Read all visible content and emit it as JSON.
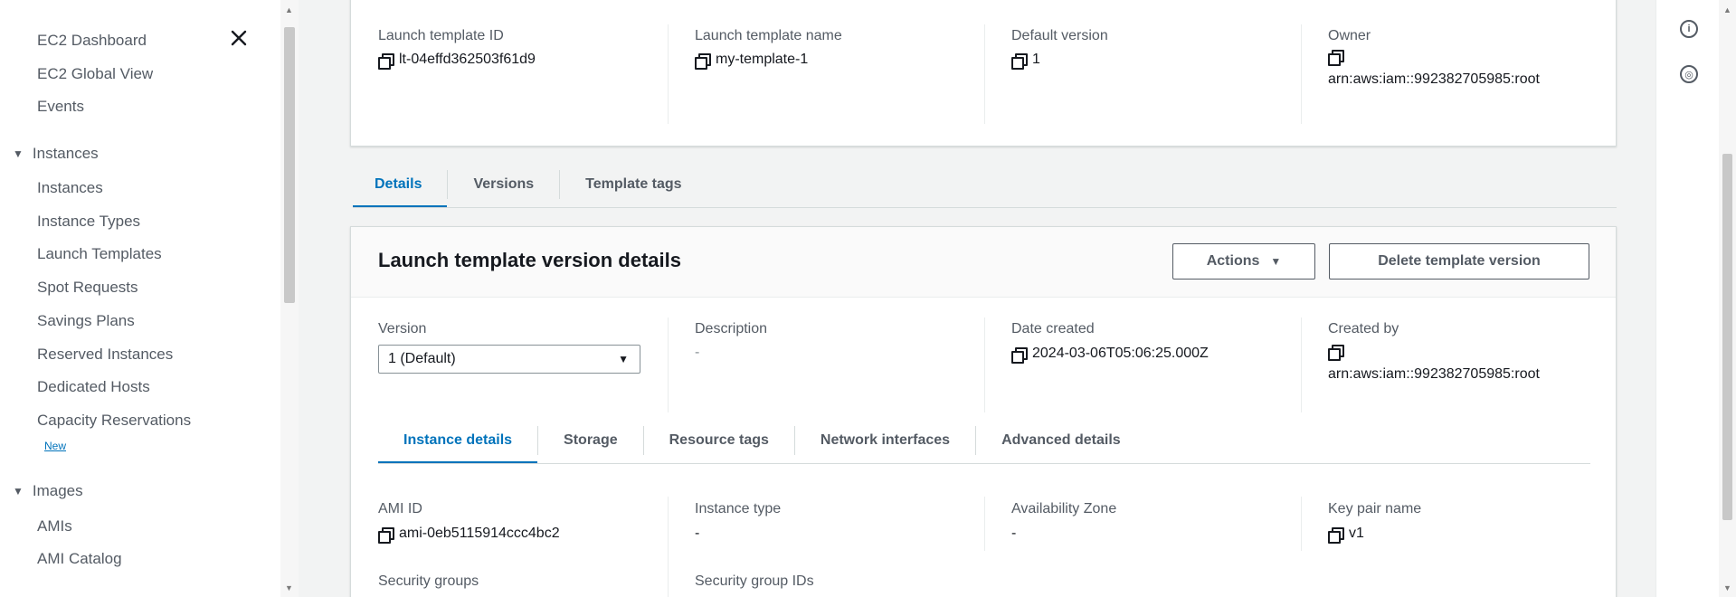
{
  "sidebar": {
    "links": [
      {
        "label": "EC2 Dashboard"
      },
      {
        "label": "EC2 Global View"
      },
      {
        "label": "Events"
      }
    ],
    "sections": [
      {
        "label": "Instances",
        "items": [
          {
            "label": "Instances"
          },
          {
            "label": "Instance Types"
          },
          {
            "label": "Launch Templates"
          },
          {
            "label": "Spot Requests"
          },
          {
            "label": "Savings Plans"
          },
          {
            "label": "Reserved Instances"
          },
          {
            "label": "Dedicated Hosts"
          },
          {
            "label": "Capacity Reservations"
          }
        ],
        "new_badge": "New"
      },
      {
        "label": "Images",
        "items": [
          {
            "label": "AMIs"
          },
          {
            "label": "AMI Catalog"
          }
        ]
      }
    ],
    "close_icon": "close-icon"
  },
  "summary": {
    "template_id_label": "Launch template ID",
    "template_id": "lt-04effd362503f61d9",
    "template_name_label": "Launch template name",
    "template_name": "my-template-1",
    "default_version_label": "Default version",
    "default_version": "1",
    "owner_label": "Owner",
    "owner": "arn:aws:iam::992382705985:root"
  },
  "top_tabs": [
    {
      "label": "Details",
      "active": true
    },
    {
      "label": "Versions",
      "active": false
    },
    {
      "label": "Template tags",
      "active": false
    }
  ],
  "version_panel": {
    "title": "Launch template version details",
    "actions_label": "Actions",
    "delete_label": "Delete template version",
    "version_label": "Version",
    "version_selected": "1 (Default)",
    "description_label": "Description",
    "description_value": "-",
    "date_created_label": "Date created",
    "date_created": "2024-03-06T05:06:25.000Z",
    "created_by_label": "Created by",
    "created_by": "arn:aws:iam::992382705985:root"
  },
  "inner_tabs": [
    {
      "label": "Instance details",
      "active": true
    },
    {
      "label": "Storage",
      "active": false
    },
    {
      "label": "Resource tags",
      "active": false
    },
    {
      "label": "Network interfaces",
      "active": false
    },
    {
      "label": "Advanced details",
      "active": false
    }
  ],
  "instance_details": {
    "ami_id_label": "AMI ID",
    "ami_id": "ami-0eb5115914ccc4bc2",
    "instance_type_label": "Instance type",
    "instance_type": "-",
    "availability_zone_label": "Availability Zone",
    "availability_zone": "-",
    "key_pair_label": "Key pair name",
    "key_pair": "v1",
    "security_groups_label": "Security groups",
    "security_group_ids_label": "Security group IDs"
  },
  "colors": {
    "accent": "#0073bb",
    "text": "#16191f",
    "muted": "#545b64",
    "background": "#f2f3f3"
  }
}
